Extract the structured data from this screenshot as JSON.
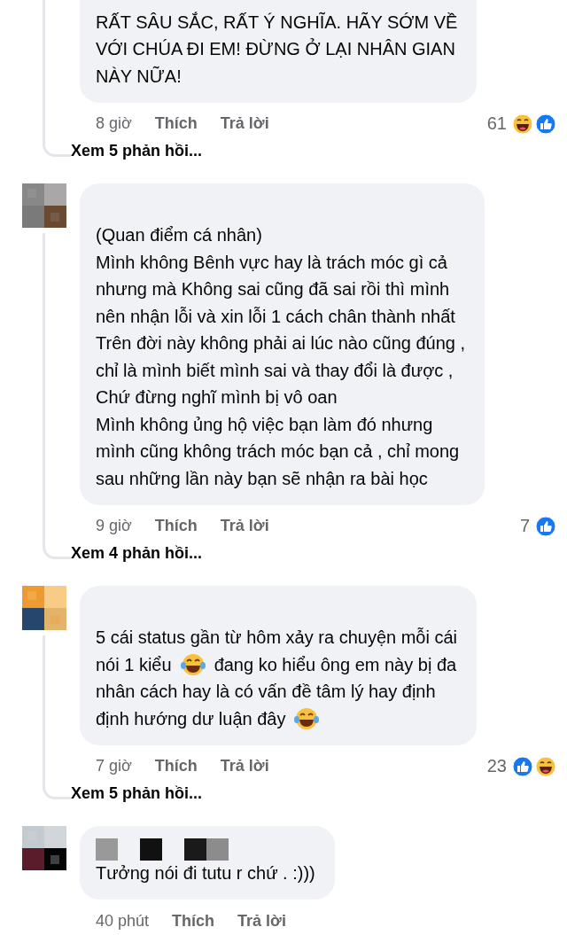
{
  "comments": [
    {
      "clipped": true,
      "name_redacted": false,
      "lines": [
        [
          {
            "kind": "text",
            "text": "RẤT SÂU SẮC, RẤT Ý NGHĨA. HÃY SỚM VỀ"
          }
        ],
        [
          {
            "kind": "text",
            "text": "VỚI CHÚA ĐI EM! ĐỪNG Ở LẠI NHÂN GIAN"
          }
        ],
        [
          {
            "kind": "text",
            "text": "NÀY NỮA!"
          }
        ]
      ],
      "time": "8 giờ",
      "like": "Thích",
      "reply": "Trả lời",
      "count": "61",
      "reactions": [
        {
          "kind": "haha"
        },
        {
          "kind": "like"
        }
      ],
      "replies": "Xem 5 phản hồi..."
    },
    {
      "clipped": false,
      "name_redacted": false,
      "lines": [
        [
          {
            "kind": "text",
            "text": "(Quan điểm cá nhân)"
          }
        ],
        [
          {
            "kind": "text",
            "text": "Mình không Bênh vực hay là trách móc gì cả"
          }
        ],
        [
          {
            "kind": "text",
            "text": "nhưng mà Không sai cũng đã sai rồi thì mình"
          }
        ],
        [
          {
            "kind": "text",
            "text": "nên nhận lỗi và xin lỗi 1 cách chân thành nhất"
          }
        ],
        [
          {
            "kind": "text",
            "text": "Trên đời này không phải ai lúc nào cũng đúng ,"
          }
        ],
        [
          {
            "kind": "text",
            "text": "chỉ là mình biết mình sai và thay đổi là được ,"
          }
        ],
        [
          {
            "kind": "text",
            "text": "Chứ đừng nghĩ mình bị vô oan"
          }
        ],
        [
          {
            "kind": "text",
            "text": "Mình không ủng hộ việc bạn làm đó nhưng"
          }
        ],
        [
          {
            "kind": "text",
            "text": "mình cũng không trách móc bạn cả , chỉ mong"
          }
        ],
        [
          {
            "kind": "text",
            "text": "sau những lần này bạn sẽ nhận ra bài học"
          }
        ]
      ],
      "time": "9 giờ",
      "like": "Thích",
      "reply": "Trả lời",
      "count": "7",
      "reactions": [
        {
          "kind": "like"
        }
      ],
      "replies": "Xem 4 phản hồi..."
    },
    {
      "clipped": false,
      "name_redacted": false,
      "lines": [
        [
          {
            "kind": "text",
            "text": "5 cái status gần từ hôm xảy ra chuyện mỗi cái"
          }
        ],
        [
          {
            "kind": "text",
            "text": "nói 1 kiểu"
          },
          {
            "kind": "emoji"
          },
          {
            "kind": "text",
            "text": "đang ko hiểu ông em này bị đa"
          }
        ],
        [
          {
            "kind": "text",
            "text": "nhân cách hay là có vấn đề tâm lý hay định"
          }
        ],
        [
          {
            "kind": "text",
            "text": "định hướng dư luận đây"
          },
          {
            "kind": "emoji"
          }
        ]
      ],
      "time": "7 giờ",
      "like": "Thích",
      "reply": "Trả lời",
      "count": "23",
      "reactions": [
        {
          "kind": "like"
        },
        {
          "kind": "haha"
        }
      ],
      "replies": "Xem 5 phản hồi..."
    },
    {
      "clipped": false,
      "name_redacted": true,
      "lines": [
        [
          {
            "kind": "text",
            "text": "Tưởng nói đi tutu r chứ . :)))"
          }
        ]
      ],
      "time": "40 phút",
      "like": "Thích",
      "reply": "Trả lời"
    }
  ]
}
